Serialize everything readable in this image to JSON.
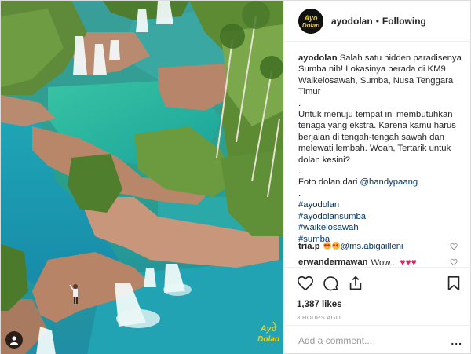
{
  "header": {
    "username": "ayodolan",
    "separator": "•",
    "follow_state": "Following"
  },
  "caption": {
    "username": "ayodolan",
    "line1": "Salah satu hidden paradisenya Sumba nih! Lokasinya berada di KM9 Waikelosawah, Sumba, Nusa Tenggara Timur",
    "dot1": ".",
    "line2": "Untuk menuju tempat ini membutuhkan tenaga yang ekstra. Karena kamu harus berjalan di tengah-tengah sawah dan melewati lembah. Woah, Tertarik untuk dolan kesini?",
    "dot2": ".",
    "credit_prefix": "Foto dolan dari ",
    "credit_handle": "@handypaang",
    "dot3": ".",
    "hashtags": [
      "#ayodolan",
      "#ayodolansumba",
      "#waikelosawah",
      "#sumba"
    ]
  },
  "comments": [
    {
      "user": "tria.p",
      "mention": "@ms.abigailleni",
      "emoji": "heart-eyes x2"
    },
    {
      "user": "erwandermawan",
      "text": "Wow...",
      "emoji": "red hearts x3"
    }
  ],
  "actions": {
    "likes": "1,387 likes",
    "time": "3 HOURS AGO"
  },
  "add_comment": {
    "placeholder": "Add a comment...",
    "more": "..."
  },
  "watermark": {
    "line1": "Ayo",
    "line2": "Dolan"
  },
  "colors": {
    "link": "#003569",
    "heart": "#e0245e",
    "logo_yellow": "#e8d21d"
  }
}
